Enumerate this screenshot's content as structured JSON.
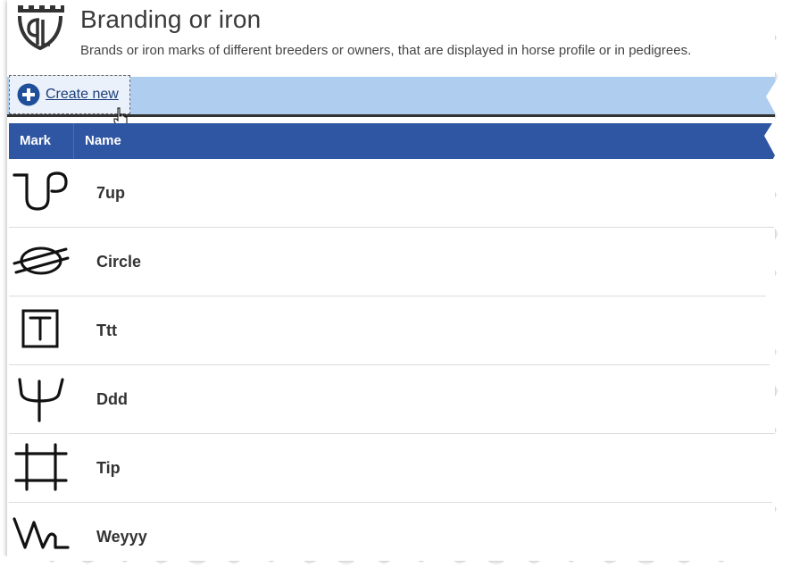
{
  "header": {
    "title": "Branding or iron",
    "subtitle": "Brands or iron marks of different breeders or owners, that are displayed in horse profile or in pedigrees.",
    "logo_icon": "castle-crown-logo"
  },
  "toolbar": {
    "create_label": "Create new",
    "create_icon": "plus-circle-icon"
  },
  "table": {
    "columns": [
      "Mark",
      "Name"
    ],
    "rows": [
      {
        "name": "7up",
        "mark_icon": "brand-7up-icon"
      },
      {
        "name": "Circle",
        "mark_icon": "brand-circle-icon"
      },
      {
        "name": "Ttt",
        "mark_icon": "brand-t-box-icon"
      },
      {
        "name": "Ddd",
        "mark_icon": "brand-trident-icon"
      },
      {
        "name": "Tip",
        "mark_icon": "brand-hash-icon"
      },
      {
        "name": "Weyyy",
        "mark_icon": "brand-w-icon"
      }
    ]
  },
  "colors": {
    "toolbar_bg": "#aecdef",
    "header_bg": "#2f56a3",
    "link": "#1d3f7a",
    "plus_icon": "#1f4f99"
  }
}
